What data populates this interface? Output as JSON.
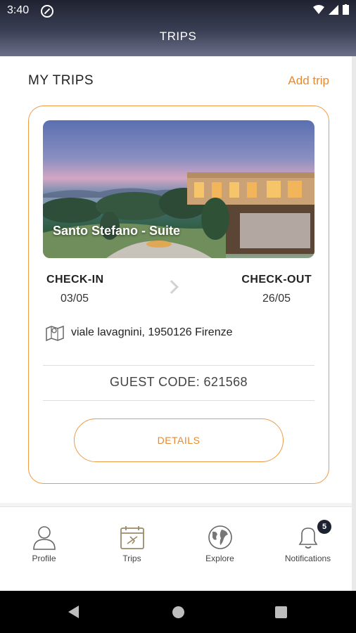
{
  "status_bar": {
    "time": "3:40"
  },
  "app_bar": {
    "title": "TRIPS"
  },
  "section": {
    "title": "MY TRIPS",
    "add_label": "Add trip"
  },
  "trip": {
    "name": "Santo Stefano - Suite",
    "checkin_label": "CHECK-IN",
    "checkin_date": "03/05",
    "checkout_label": "CHECK-OUT",
    "checkout_date": "26/05",
    "address": "viale lavagnini, 1950126 Firenze",
    "guest_code": "GUEST CODE: 621568",
    "details_label": "DETAILS"
  },
  "bottom_nav": {
    "items": [
      {
        "label": "Profile",
        "icon": "person-icon"
      },
      {
        "label": "Trips",
        "icon": "trips-calendar-icon"
      },
      {
        "label": "Explore",
        "icon": "globe-icon"
      },
      {
        "label": "Notifications",
        "icon": "bell-icon"
      }
    ],
    "notifications_badge": "5"
  },
  "colors": {
    "accent": "#e8892e",
    "card_border": "#ef9a45",
    "app_bar": "#2e3244",
    "badge": "#1e2230"
  }
}
